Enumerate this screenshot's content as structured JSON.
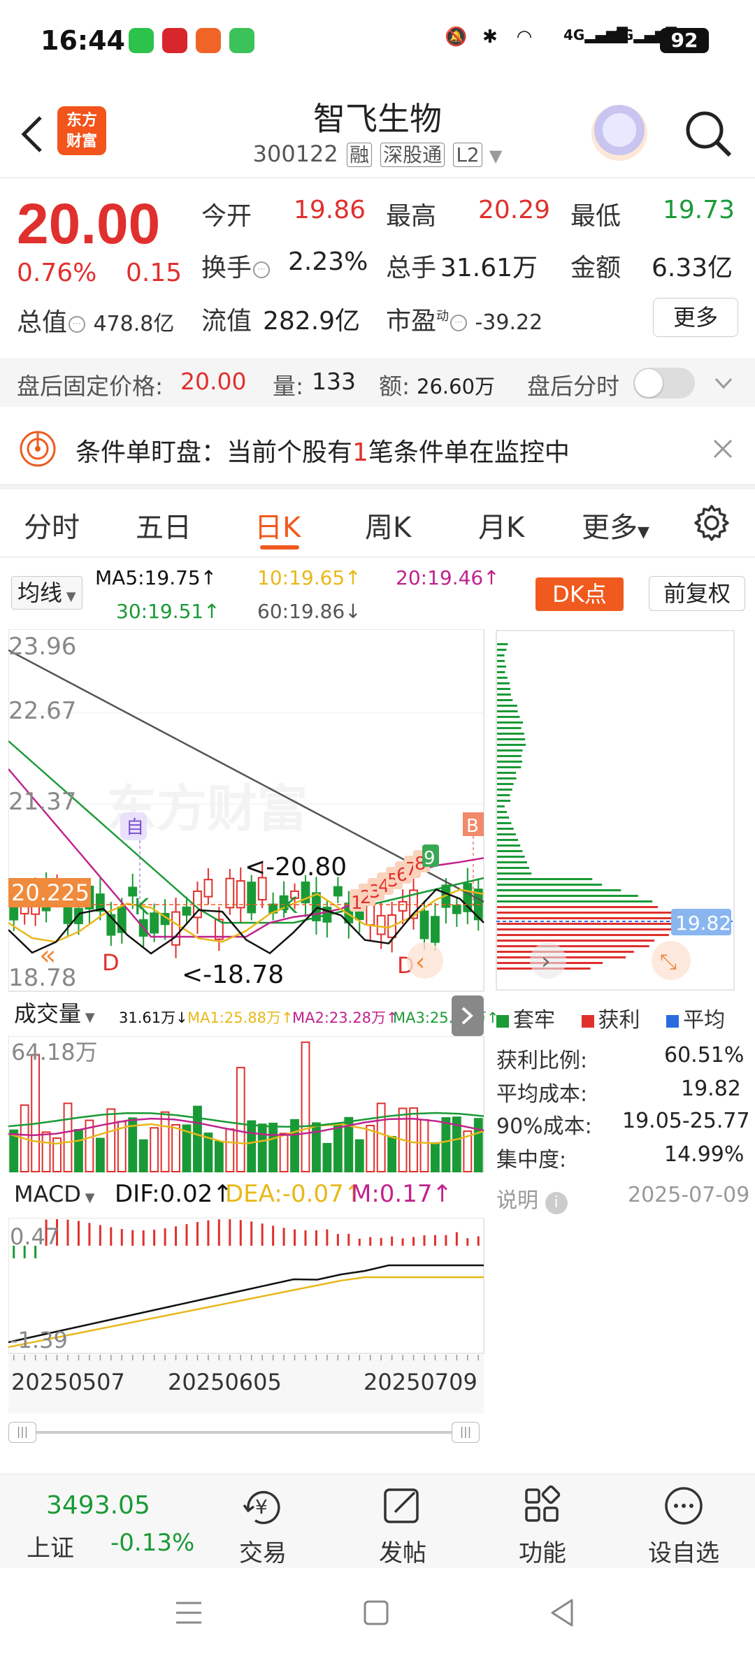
{
  "status": {
    "time": "16:44",
    "battery": "92",
    "net1": "4G",
    "net2": "4G"
  },
  "header": {
    "title": "智飞生物",
    "code": "300122",
    "tag1": "融",
    "tag2": "深股通",
    "tag3": "L2",
    "logo_line1": "东方",
    "logo_line2": "财富"
  },
  "quote": {
    "price": "20.00",
    "pct": "0.76%",
    "chg": "0.15",
    "open_l": "今开",
    "open": "19.86",
    "high_l": "最高",
    "high": "20.29",
    "low_l": "最低",
    "low": "19.73",
    "turn_l": "换手",
    "turn": "2.23%",
    "vol_l": "总手",
    "vol": "31.61万",
    "amt_l": "金额",
    "amt": "6.33亿",
    "mcap_l": "总值",
    "mcap": "478.8亿",
    "float_l": "流值",
    "float": "282.9亿",
    "pe_l": "市盈",
    "pe_sup": "动",
    "pe": "-39.22",
    "more": "更多"
  },
  "afterhours": {
    "price_l": "盘后固定价格:",
    "price": "20.00",
    "vol_l": "量:",
    "vol": "133",
    "amt_l": "额:",
    "amt": "26.60万",
    "toggle_l": "盘后分时"
  },
  "condition": {
    "prefix": "条件单盯盘：当前个股有",
    "count": "1",
    "suffix": "笔条件单在监控中"
  },
  "tabs": [
    "分时",
    "五日",
    "日K",
    "周K",
    "月K",
    "更多"
  ],
  "ma": {
    "selector": "均线",
    "ma5": "MA5:19.75↑",
    "ma10": "10:19.65↑",
    "ma20": "20:19.46↑",
    "ma30": "30:19.51↑",
    "ma60": "60:19.86↓",
    "dk": "DK点",
    "fq": "前复权"
  },
  "kchart": {
    "y_labels": [
      "23.96",
      "22.67",
      "21.37",
      "18.78"
    ],
    "cur": "20.225",
    "max_label": "<-20.80",
    "min_label": "<-18.78",
    "mark_self": "自",
    "mark_b": "B",
    "mark_k1": "K",
    "mark_k2": "K",
    "mark_d1": "D",
    "mark_d2": "D",
    "seq": [
      "1",
      "2",
      "3",
      "4",
      "5",
      "6",
      "7",
      "8",
      "9"
    ],
    "watermark": "东方财富"
  },
  "volume": {
    "selector": "成交量",
    "v": "31.61万↓",
    "ma1": "MA1:25.88万↑",
    "ma2": "MA2:23.28万↑",
    "ma3": "MA3:25.54万↑",
    "max": "64.18万"
  },
  "macd": {
    "selector": "MACD",
    "dif": "DIF:0.02↑",
    "dea": "DEA:-0.07↑",
    "m": "M:0.17↑",
    "top": "0.47",
    "bottom": "-1.39"
  },
  "dates": [
    "20250507",
    "20250605",
    "20250709"
  ],
  "chip": {
    "price": "19.82",
    "legend": [
      "套牢",
      "获利",
      "平均"
    ],
    "rows": [
      {
        "label": "获利比例:",
        "value": "60.51%"
      },
      {
        "label": "平均成本:",
        "value": "19.82"
      },
      {
        "label": "90%成本:",
        "value": "19.05-25.77"
      },
      {
        "label": "集中度:",
        "value": "14.99%"
      }
    ],
    "note": "说明",
    "date": "2025-07-09"
  },
  "bottombar": {
    "index_value": "3493.05",
    "index_name": "上证",
    "index_pct": "-0.13%",
    "items": [
      "交易",
      "发帖",
      "功能",
      "设自选"
    ]
  },
  "colors": {
    "up": "#e0302d",
    "down": "#1a9a36",
    "accent": "#f05a1e"
  }
}
